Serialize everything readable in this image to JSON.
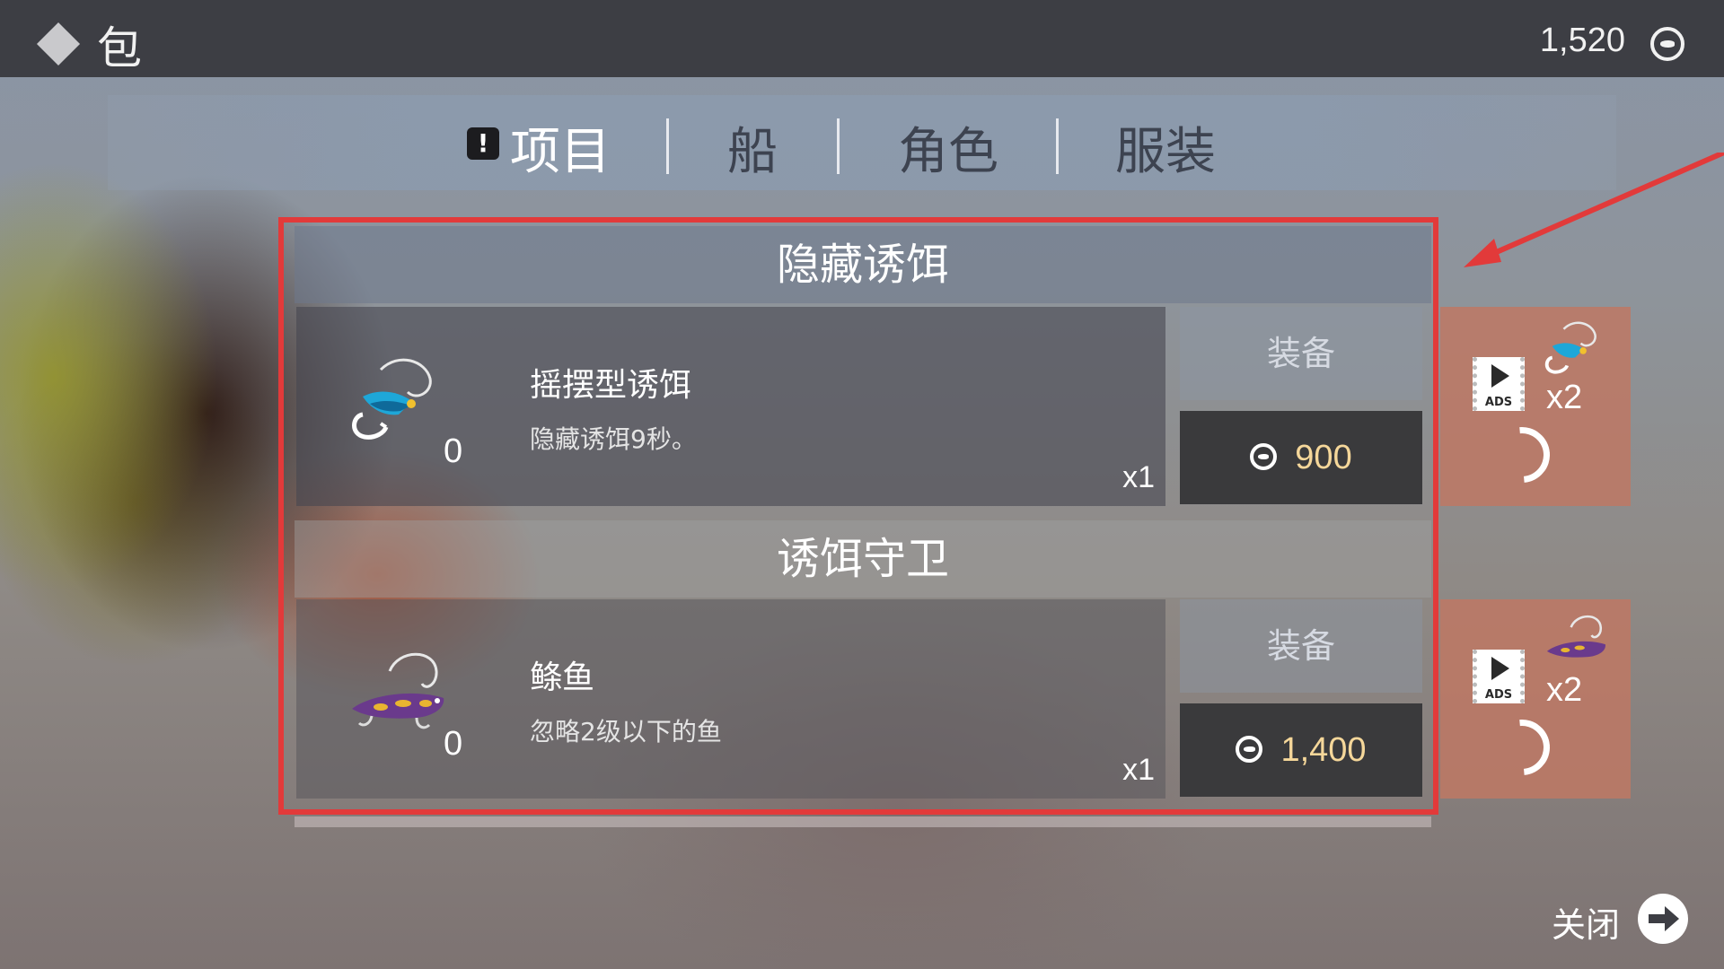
{
  "header": {
    "title": "包",
    "coins": "1,520"
  },
  "tabs": [
    {
      "label": "项目",
      "active": true,
      "has_alert": true
    },
    {
      "label": "船",
      "active": false
    },
    {
      "label": "角色",
      "active": false
    },
    {
      "label": "服装",
      "active": false
    }
  ],
  "sections": [
    {
      "title": "隐藏诱饵",
      "item": {
        "name": "摇摆型诱饵",
        "description": "隐藏诱饵9秒。",
        "owned": "0",
        "quantity": "x1",
        "icon": "fly-lure-icon"
      },
      "equip_label": "装备",
      "price": "900",
      "ads": {
        "label": "ADS",
        "multiplier": "x2"
      }
    },
    {
      "title": "诱饵守卫",
      "item": {
        "name": "鲦鱼",
        "description": "忽略2级以下的鱼",
        "owned": "0",
        "quantity": "x1",
        "icon": "minnow-lure-icon"
      },
      "equip_label": "装备",
      "price": "1,400",
      "ads": {
        "label": "ADS",
        "multiplier": "x2"
      }
    }
  ],
  "close_label": "关闭",
  "colors": {
    "topbar": "#3d3e44",
    "highlight": "#e23a3a",
    "price_text": "#f5d79a",
    "ads_card": "#be7864"
  }
}
